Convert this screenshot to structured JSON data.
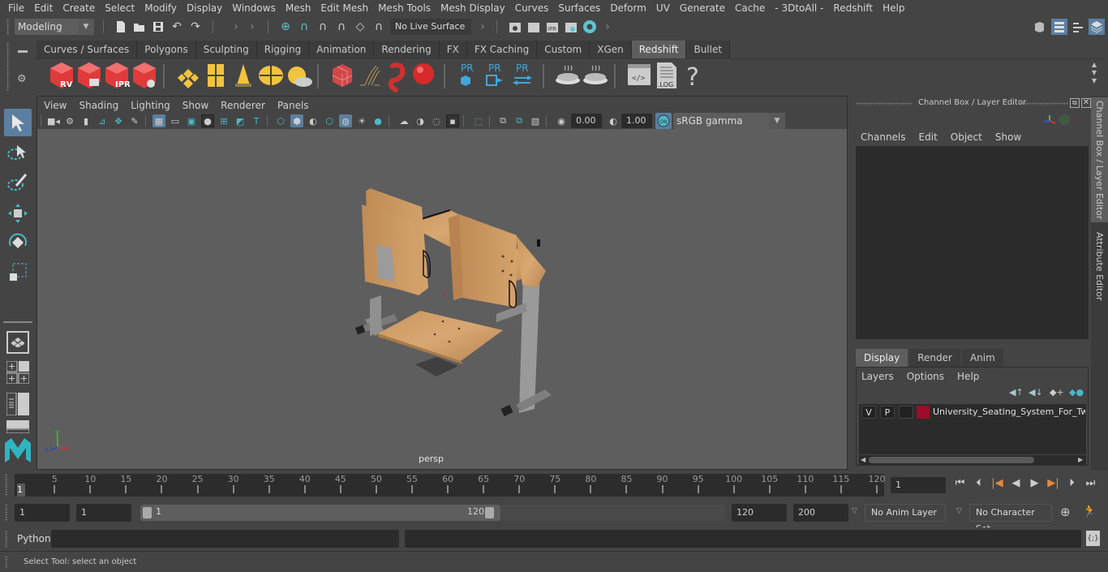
{
  "menubar": {
    "items": [
      "File",
      "Edit",
      "Create",
      "Select",
      "Modify",
      "Display",
      "Windows",
      "Mesh",
      "Edit Mesh",
      "Mesh Tools",
      "Mesh Display",
      "Curves",
      "Surfaces",
      "Deform",
      "UV",
      "Generate",
      "Cache",
      "- 3DtoAll -",
      "Redshift",
      "Help"
    ]
  },
  "statusline": {
    "workspace": "Modeling",
    "live_surface": "No Live Surface",
    "icons": [
      "new-scene-icon",
      "open-scene-icon",
      "save-scene-icon",
      "undo-icon",
      "redo-icon",
      "snap-grid-icon",
      "snap-curve-icon",
      "snap-point-icon",
      "snap-projected-center-icon",
      "snap-view-plane-icon",
      "make-live-icon",
      "render-view-icon",
      "render-current-icon",
      "ipr-render-icon",
      "render-settings-icon",
      "hypershade-icon"
    ],
    "right_icons": [
      "modeling-toolkit-icon",
      "attribute-editor-icon",
      "tool-settings-icon",
      "channel-box-icon"
    ]
  },
  "shelf": {
    "tabs": [
      "Curves / Surfaces",
      "Polygons",
      "Sculpting",
      "Rigging",
      "Animation",
      "Rendering",
      "FX",
      "FX Caching",
      "Custom",
      "XGen",
      "Redshift",
      "Bullet"
    ],
    "active_tab": "Redshift",
    "buttons": [
      {
        "name": "rs-render-view",
        "label": "RV"
      },
      {
        "name": "rs-batch-render",
        "label": ""
      },
      {
        "name": "rs-ipr",
        "label": "IPR"
      },
      {
        "name": "rs-render-settings",
        "label": ""
      },
      {
        "name": "rs-area-light",
        "label": ""
      },
      {
        "name": "rs-portal-light",
        "label": ""
      },
      {
        "name": "rs-ies-light",
        "label": ""
      },
      {
        "name": "rs-dome-light",
        "label": ""
      },
      {
        "name": "rs-sun-sky",
        "label": ""
      },
      {
        "name": "rs-volume",
        "label": ""
      },
      {
        "name": "rs-hair",
        "label": ""
      },
      {
        "name": "rs-mesh-light",
        "label": ""
      },
      {
        "name": "rs-sphere",
        "label": ""
      },
      {
        "name": "rs-proxy-export",
        "label": "PR"
      },
      {
        "name": "rs-proxy-import",
        "label": "PR"
      },
      {
        "name": "rs-proxy-convert",
        "label": "PR"
      },
      {
        "name": "rs-bake-multi",
        "label": ""
      },
      {
        "name": "rs-bake",
        "label": ""
      },
      {
        "name": "rs-script-editor",
        "label": ""
      },
      {
        "name": "rs-log",
        "label": ".LOG"
      },
      {
        "name": "rs-help",
        "label": "?"
      }
    ]
  },
  "viewport": {
    "menu": [
      "View",
      "Shading",
      "Lighting",
      "Show",
      "Renderer",
      "Panels"
    ],
    "exposure": "0.00",
    "gamma": "1.00",
    "color_space": "sRGB gamma",
    "camera_label": "persp",
    "axis": {
      "x": "x",
      "y": "y",
      "z": "z"
    }
  },
  "channel_box": {
    "title": "Channel Box / Layer Editor",
    "menu": [
      "Channels",
      "Edit",
      "Object",
      "Show"
    ],
    "layer_tabs": [
      "Display",
      "Render",
      "Anim"
    ],
    "active_layer_tab": "Display",
    "layer_menu": [
      "Layers",
      "Options",
      "Help"
    ],
    "layers": [
      {
        "visible": "V",
        "playback": "P",
        "type": "",
        "color": "#9b0d2a",
        "name": "University_Seating_System_For_Two_"
      }
    ]
  },
  "side_tabs": [
    "Channel Box / Layer Editor",
    "Attribute Editor"
  ],
  "timeline": {
    "ticks": [
      5,
      10,
      15,
      20,
      25,
      30,
      35,
      40,
      45,
      50,
      55,
      60,
      65,
      70,
      75,
      80,
      85,
      90,
      95,
      100,
      105,
      110,
      115,
      120
    ],
    "min": 1,
    "max": 120,
    "current_frame_marker": "1",
    "current_frame": "1"
  },
  "range": {
    "start_time": "1",
    "playback_start": "1",
    "slider_start": "1",
    "slider_end": "120",
    "playback_end": "120",
    "end_time": "200",
    "anim_layer": "No Anim Layer",
    "character_set": "No Character Set"
  },
  "cmdline": {
    "language": "Python"
  },
  "helpline": {
    "text": "Select Tool: select an object"
  }
}
